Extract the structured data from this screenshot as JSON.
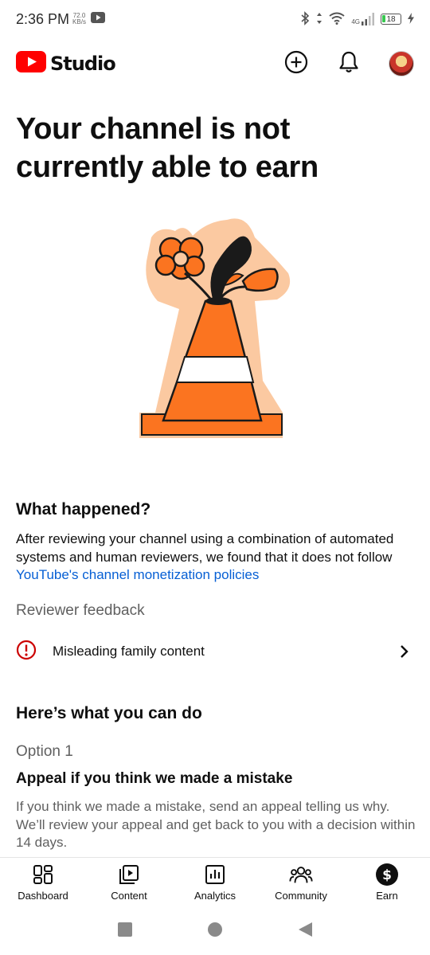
{
  "status_bar": {
    "time": "2:36 PM",
    "speed_value": "72.0",
    "speed_unit": "KB/s",
    "network": "4G",
    "battery": "18"
  },
  "header": {
    "app_name": "Studio",
    "brand_color": "#ff0000",
    "icons": [
      "create-icon",
      "bell-icon",
      "avatar"
    ]
  },
  "page": {
    "title": "Your channel is not currently able to earn"
  },
  "what_happened": {
    "heading": "What happened?",
    "body": "After reviewing your channel using a combination of automated systems and human reviewers, we found that it does not follow ",
    "link": "YouTube's channel monetization policies",
    "link_color": "#065fd4"
  },
  "reviewer_feedback": {
    "heading": "Reviewer feedback",
    "item_label": "Misleading family content",
    "alert_color": "#cc0000"
  },
  "what_you_can_do": {
    "heading": "Here’s what you can do",
    "option_label": "Option 1",
    "option_title": "Appeal if you think we made a mistake",
    "option_body": "If you think we made a mistake, send an appeal telling us why. We’ll review your appeal and get back to you with a decision within 14 days."
  },
  "bottom_nav": {
    "items": [
      {
        "label": "Dashboard",
        "icon": "dashboard-icon"
      },
      {
        "label": "Content",
        "icon": "content-icon"
      },
      {
        "label": "Analytics",
        "icon": "analytics-icon"
      },
      {
        "label": "Community",
        "icon": "community-icon"
      },
      {
        "label": "Earn",
        "icon": "earn-icon",
        "selected": true
      }
    ]
  },
  "system_nav": [
    "recents-button",
    "home-button",
    "back-button"
  ]
}
